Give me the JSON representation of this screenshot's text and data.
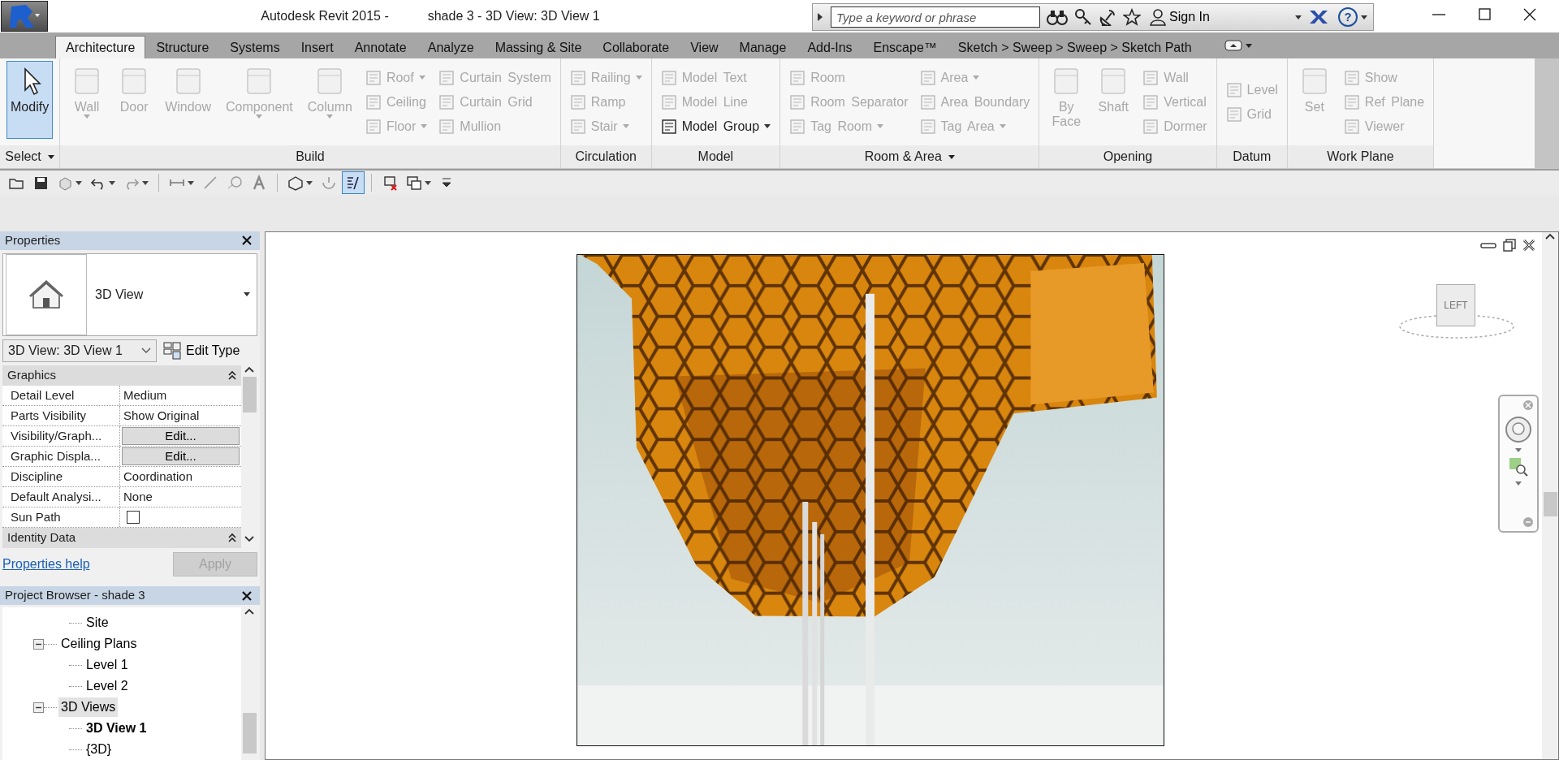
{
  "window": {
    "app_title": "Autodesk Revit 2015 -",
    "doc_title": "shade 3 - 3D View: 3D View 1"
  },
  "infocenter": {
    "placeholder": "Type a keyword or phrase",
    "sign_in": "Sign In",
    "help": "?"
  },
  "tabs": [
    {
      "label": "Architecture",
      "selected": true
    },
    {
      "label": "Structure",
      "selected": false
    },
    {
      "label": "Systems",
      "selected": false
    },
    {
      "label": "Insert",
      "selected": false
    },
    {
      "label": "Annotate",
      "selected": false
    },
    {
      "label": "Analyze",
      "selected": false
    },
    {
      "label": "Massing & Site",
      "selected": false
    },
    {
      "label": "Collaborate",
      "selected": false
    },
    {
      "label": "View",
      "selected": false
    },
    {
      "label": "Manage",
      "selected": false
    },
    {
      "label": "Add-Ins",
      "selected": false
    },
    {
      "label": "Enscape™",
      "selected": false
    },
    {
      "label": "Sketch > Sweep > Sweep > Sketch Path",
      "selected": false
    }
  ],
  "ribbon_panels": [
    {
      "title": "Select",
      "has_menu": true,
      "tools": [
        {
          "label": "Modify",
          "kind": "large",
          "disabled": false,
          "selected": true
        }
      ]
    },
    {
      "title": "Build",
      "tools": [
        {
          "label": "Wall",
          "kind": "large",
          "disabled": true,
          "selected": false,
          "dropdown": true
        },
        {
          "label": "Door",
          "kind": "large",
          "disabled": true,
          "selected": false
        },
        {
          "label": "Window",
          "kind": "large",
          "disabled": true,
          "selected": false
        },
        {
          "label": "Component",
          "kind": "large",
          "disabled": true,
          "selected": false,
          "dropdown": true
        },
        {
          "label": "Column",
          "kind": "large",
          "disabled": true,
          "selected": false,
          "dropdown": true
        },
        {
          "label": "Roof",
          "kind": "small",
          "disabled": true,
          "selected": false,
          "dropdown": true
        },
        {
          "label": "Ceiling",
          "kind": "small",
          "disabled": true,
          "selected": false
        },
        {
          "label": "Floor",
          "kind": "small",
          "disabled": true,
          "selected": false,
          "dropdown": true
        },
        {
          "label": "Curtain System",
          "kind": "small",
          "disabled": true,
          "selected": false
        },
        {
          "label": "Curtain Grid",
          "kind": "small",
          "disabled": true,
          "selected": false
        },
        {
          "label": "Mullion",
          "kind": "small",
          "disabled": true,
          "selected": false
        }
      ]
    },
    {
      "title": "Circulation",
      "tools": [
        {
          "label": "Railing",
          "kind": "small",
          "disabled": true,
          "selected": false,
          "dropdown": true
        },
        {
          "label": "Ramp",
          "kind": "small",
          "disabled": true,
          "selected": false
        },
        {
          "label": "Stair",
          "kind": "small",
          "disabled": true,
          "selected": false,
          "dropdown": true
        }
      ]
    },
    {
      "title": "Model",
      "tools": [
        {
          "label": "Model Text",
          "kind": "small",
          "disabled": true,
          "selected": false
        },
        {
          "label": "Model Line",
          "kind": "small",
          "disabled": true,
          "selected": false
        },
        {
          "label": "Model Group",
          "kind": "small",
          "disabled": false,
          "selected": false,
          "dropdown": true
        }
      ]
    },
    {
      "title": "Room & Area",
      "has_menu": true,
      "tools": [
        {
          "label": "Room",
          "kind": "small",
          "disabled": true,
          "selected": false
        },
        {
          "label": "Room Separator",
          "kind": "small",
          "disabled": true,
          "selected": false
        },
        {
          "label": "Tag Room",
          "kind": "small",
          "disabled": true,
          "selected": false,
          "dropdown": true
        },
        {
          "label": "Area",
          "kind": "small",
          "disabled": true,
          "selected": false,
          "dropdown": true
        },
        {
          "label": "Area Boundary",
          "kind": "small",
          "disabled": true,
          "selected": false
        },
        {
          "label": "Tag Area",
          "kind": "small",
          "disabled": true,
          "selected": false,
          "dropdown": true
        }
      ]
    },
    {
      "title": "Opening",
      "tools": [
        {
          "label": "By Face",
          "kind": "large",
          "disabled": true,
          "selected": false
        },
        {
          "label": "Shaft",
          "kind": "large",
          "disabled": true,
          "selected": false
        },
        {
          "label": "Wall",
          "kind": "small",
          "disabled": true,
          "selected": false
        },
        {
          "label": "Vertical",
          "kind": "small",
          "disabled": true,
          "selected": false
        },
        {
          "label": "Dormer",
          "kind": "small",
          "disabled": true,
          "selected": false
        }
      ]
    },
    {
      "title": "Datum",
      "tools": [
        {
          "label": "Level",
          "kind": "small",
          "disabled": true,
          "selected": false
        },
        {
          "label": "Grid",
          "kind": "small",
          "disabled": true,
          "selected": false
        }
      ]
    },
    {
      "title": "Work Plane",
      "tools": [
        {
          "label": "Set",
          "kind": "large",
          "disabled": true,
          "selected": false
        },
        {
          "label": "Show",
          "kind": "small",
          "disabled": true,
          "selected": false
        },
        {
          "label": "Ref Plane",
          "kind": "small",
          "disabled": true,
          "selected": false
        },
        {
          "label": "Viewer",
          "kind": "small",
          "disabled": true,
          "selected": false
        }
      ]
    }
  ],
  "quick_access": [
    {
      "kind": "button",
      "on": false
    },
    {
      "kind": "button",
      "on": false
    },
    {
      "kind": "button",
      "on": false,
      "dropdown": true
    },
    {
      "kind": "button",
      "on": false,
      "dropdown": true
    },
    {
      "kind": "button",
      "on": false,
      "dropdown": true
    },
    {
      "kind": "button",
      "on": false,
      "dropdown": true,
      "separator_before": true
    },
    {
      "kind": "button",
      "on": false
    },
    {
      "kind": "button",
      "on": false
    },
    {
      "kind": "button",
      "on": false
    },
    {
      "kind": "button",
      "on": false,
      "dropdown": true,
      "separator_before": true
    },
    {
      "kind": "button",
      "on": false
    },
    {
      "kind": "button",
      "on": true
    },
    {
      "kind": "button",
      "on": false,
      "separator_before": true
    },
    {
      "kind": "button",
      "on": false,
      "dropdown": true
    },
    {
      "kind": "menu",
      "on": false
    }
  ],
  "properties": {
    "title": "Properties",
    "type_name": "3D View",
    "instance": "3D View: 3D View 1",
    "edit_type": "Edit Type",
    "groups": [
      {
        "title": "Graphics",
        "rows": [
          {
            "name": "Detail Level",
            "kind": "text",
            "value": "Medium"
          },
          {
            "name": "Parts Visibility",
            "kind": "text",
            "value": "Show Original"
          },
          {
            "name": "Visibility/Graph...",
            "kind": "button",
            "value": "Edit..."
          },
          {
            "name": "Graphic Displa...",
            "kind": "button",
            "value": "Edit..."
          },
          {
            "name": "Discipline",
            "kind": "text",
            "value": "Coordination"
          },
          {
            "name": "Default Analysi...",
            "kind": "text",
            "value": "None"
          },
          {
            "name": "Sun Path",
            "kind": "checkbox",
            "checked": false
          }
        ]
      },
      {
        "title": "Identity Data"
      }
    ],
    "help": "Properties help",
    "apply": {
      "label": "Apply",
      "disabled": true
    }
  },
  "project_browser": {
    "title": "Project Browser - shade 3",
    "items": [
      {
        "label": "Site",
        "selected": false,
        "active_view": false
      },
      {
        "label": "Ceiling Plans",
        "expanded": true,
        "selected": false,
        "active_view": false,
        "children": [
          {
            "label": "Level 1",
            "selected": false,
            "active_view": false
          },
          {
            "label": "Level 2",
            "selected": false,
            "active_view": false
          }
        ]
      },
      {
        "label": "3D Views",
        "expanded": true,
        "selected": true,
        "active_view": false,
        "children": [
          {
            "label": "3D View 1",
            "selected": false,
            "active_view": true
          },
          {
            "label": "{3D}",
            "selected": false,
            "active_view": false
          }
        ]
      }
    ]
  },
  "view": {
    "viewcube_face": "LEFT"
  }
}
